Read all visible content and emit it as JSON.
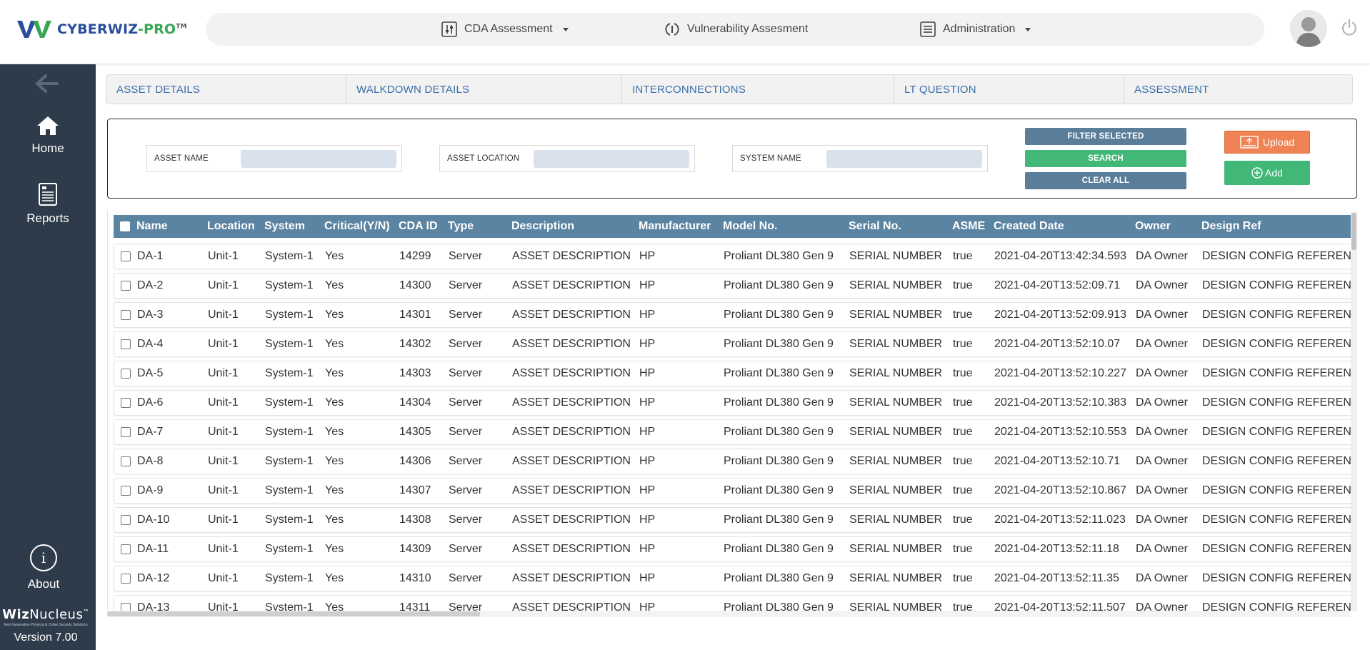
{
  "header": {
    "logo": {
      "part1": "CYBER",
      "part2": "WIZ",
      "part3": "-PRO",
      "mark": "TM"
    },
    "nav": [
      {
        "label": "CDA Assessment",
        "icon": "sliders-icon",
        "dropdown": true
      },
      {
        "label": "Vulnerability Assesment",
        "icon": "refresh-shield-icon",
        "dropdown": false
      },
      {
        "label": "Administration",
        "icon": "list-icon",
        "dropdown": true
      }
    ]
  },
  "sidebar": {
    "items": [
      {
        "label": "Home",
        "icon": "home-icon"
      },
      {
        "label": "Reports",
        "icon": "report-icon"
      }
    ],
    "about": "About",
    "brand": {
      "name_bold": "Wiz",
      "name_rest": "Nucleus",
      "mark": "™",
      "tagline": "Next Generation Physical & Cyber Security Solutions"
    },
    "version": "Version 7.00"
  },
  "tabs": [
    "ASSET DETAILS",
    "WALKDOWN DETAILS",
    "INTERCONNECTIONS",
    "LT QUESTION",
    "ASSESSMENT"
  ],
  "filters": {
    "asset_name": "ASSET NAME",
    "asset_location": "ASSET LOCATION",
    "system_name": "SYSTEM NAME",
    "asset_name_value": "",
    "asset_location_value": "",
    "system_name_value": ""
  },
  "buttons": {
    "filter_selected": "FILTER SELECTED",
    "search": "SEARCH",
    "clear_all": "CLEAR ALL",
    "upload": "Upload",
    "add": "Add"
  },
  "table": {
    "columns": [
      "Name",
      "Location",
      "System",
      "Critical(Y/N)",
      "CDA ID",
      "Type",
      "Description",
      "Manufacturer",
      "Model No.",
      "Serial No.",
      "ASME",
      "Created Date",
      "Owner",
      "Design Ref"
    ],
    "rows": [
      [
        "DA-1",
        "Unit-1",
        "System-1",
        "Yes",
        "14299",
        "Server",
        "ASSET DESCRIPTION",
        "HP",
        "Proliant DL380 Gen 9",
        "SERIAL NUMBER",
        "true",
        "2021-04-20T13:42:34.593",
        "DA Owner",
        "DESIGN CONFIG REFERENCE"
      ],
      [
        "DA-2",
        "Unit-1",
        "System-1",
        "Yes",
        "14300",
        "Server",
        "ASSET DESCRIPTION",
        "HP",
        "Proliant DL380 Gen 9",
        "SERIAL NUMBER",
        "true",
        "2021-04-20T13:52:09.71",
        "DA Owner",
        "DESIGN CONFIG REFERENCE"
      ],
      [
        "DA-3",
        "Unit-1",
        "System-1",
        "Yes",
        "14301",
        "Server",
        "ASSET DESCRIPTION",
        "HP",
        "Proliant DL380 Gen 9",
        "SERIAL NUMBER",
        "true",
        "2021-04-20T13:52:09.913",
        "DA Owner",
        "DESIGN CONFIG REFERENCE"
      ],
      [
        "DA-4",
        "Unit-1",
        "System-1",
        "Yes",
        "14302",
        "Server",
        "ASSET DESCRIPTION",
        "HP",
        "Proliant DL380 Gen 9",
        "SERIAL NUMBER",
        "true",
        "2021-04-20T13:52:10.07",
        "DA Owner",
        "DESIGN CONFIG REFERENCE"
      ],
      [
        "DA-5",
        "Unit-1",
        "System-1",
        "Yes",
        "14303",
        "Server",
        "ASSET DESCRIPTION",
        "HP",
        "Proliant DL380 Gen 9",
        "SERIAL NUMBER",
        "true",
        "2021-04-20T13:52:10.227",
        "DA Owner",
        "DESIGN CONFIG REFERENCE"
      ],
      [
        "DA-6",
        "Unit-1",
        "System-1",
        "Yes",
        "14304",
        "Server",
        "ASSET DESCRIPTION",
        "HP",
        "Proliant DL380 Gen 9",
        "SERIAL NUMBER",
        "true",
        "2021-04-20T13:52:10.383",
        "DA Owner",
        "DESIGN CONFIG REFERENCE"
      ],
      [
        "DA-7",
        "Unit-1",
        "System-1",
        "Yes",
        "14305",
        "Server",
        "ASSET DESCRIPTION",
        "HP",
        "Proliant DL380 Gen 9",
        "SERIAL NUMBER",
        "true",
        "2021-04-20T13:52:10.553",
        "DA Owner",
        "DESIGN CONFIG REFERENCE"
      ],
      [
        "DA-8",
        "Unit-1",
        "System-1",
        "Yes",
        "14306",
        "Server",
        "ASSET DESCRIPTION",
        "HP",
        "Proliant DL380 Gen 9",
        "SERIAL NUMBER",
        "true",
        "2021-04-20T13:52:10.71",
        "DA Owner",
        "DESIGN CONFIG REFERENCE"
      ],
      [
        "DA-9",
        "Unit-1",
        "System-1",
        "Yes",
        "14307",
        "Server",
        "ASSET DESCRIPTION",
        "HP",
        "Proliant DL380 Gen 9",
        "SERIAL NUMBER",
        "true",
        "2021-04-20T13:52:10.867",
        "DA Owner",
        "DESIGN CONFIG REFERENCE"
      ],
      [
        "DA-10",
        "Unit-1",
        "System-1",
        "Yes",
        "14308",
        "Server",
        "ASSET DESCRIPTION",
        "HP",
        "Proliant DL380 Gen 9",
        "SERIAL NUMBER",
        "true",
        "2021-04-20T13:52:11.023",
        "DA Owner",
        "DESIGN CONFIG REFERENCE"
      ],
      [
        "DA-11",
        "Unit-1",
        "System-1",
        "Yes",
        "14309",
        "Server",
        "ASSET DESCRIPTION",
        "HP",
        "Proliant DL380 Gen 9",
        "SERIAL NUMBER",
        "true",
        "2021-04-20T13:52:11.18",
        "DA Owner",
        "DESIGN CONFIG REFERENCE"
      ],
      [
        "DA-12",
        "Unit-1",
        "System-1",
        "Yes",
        "14310",
        "Server",
        "ASSET DESCRIPTION",
        "HP",
        "Proliant DL380 Gen 9",
        "SERIAL NUMBER",
        "true",
        "2021-04-20T13:52:11.35",
        "DA Owner",
        "DESIGN CONFIG REFERENCE"
      ],
      [
        "DA-13",
        "Unit-1",
        "System-1",
        "Yes",
        "14311",
        "Server",
        "ASSET DESCRIPTION",
        "HP",
        "Proliant DL380 Gen 9",
        "SERIAL NUMBER",
        "true",
        "2021-04-20T13:52:11.507",
        "DA Owner",
        "DESIGN CONFIG REFERENCE"
      ]
    ]
  },
  "colors": {
    "sidebar_bg": "#2e3b4a",
    "table_header": "#5b84a3",
    "tab_text": "#3a6ea8",
    "search_green": "#41b877",
    "upload_orange": "#ef8354",
    "filter_blue": "#5a7d99"
  }
}
